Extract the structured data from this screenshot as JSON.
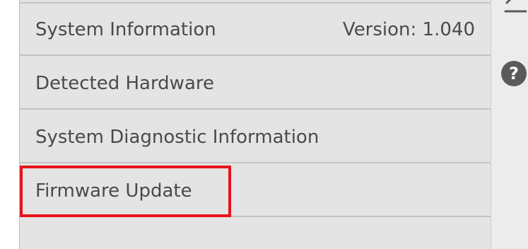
{
  "menu": {
    "items": [
      {
        "label": "System Information",
        "value": "Version: 1.040"
      },
      {
        "label": "Detected Hardware"
      },
      {
        "label": "System Diagnostic Information"
      },
      {
        "label": "Firmware Update"
      }
    ]
  },
  "side_rail": {
    "help_glyph": "?",
    "icons": [
      "back-icon",
      "help-icon"
    ]
  },
  "colors": {
    "highlight": "#e8141b",
    "panel_background": "#e4e4e4",
    "text": "#4a4a4a",
    "help_icon": "#5a5a5a"
  }
}
